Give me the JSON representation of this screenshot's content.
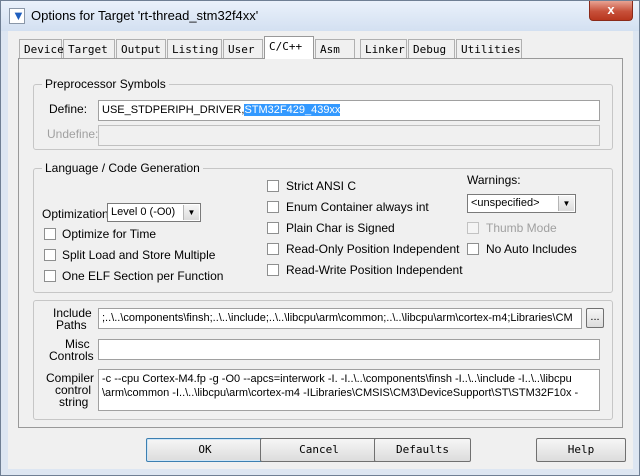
{
  "window": {
    "title": "Options for Target 'rt-thread_stm32f4xx'",
    "close_glyph": "x",
    "icon_glyph": "▼"
  },
  "tabs": [
    "Device",
    "Target",
    "Output",
    "Listing",
    "User",
    "C/C++",
    "Asm",
    "Linker",
    "Debug",
    "Utilities"
  ],
  "active_tab": "C/C++",
  "preprocessor": {
    "legend": "Preprocessor Symbols",
    "define_label": "Define:",
    "define_value_plain": "USE_STDPERIPH_DRIVER,",
    "define_value_selected": "STM32F429_439xx",
    "undefine_label": "Undefine:",
    "undefine_value": ""
  },
  "language": {
    "legend": "Language / Code Generation",
    "optimization_label": "Optimization:",
    "optimization_value": "Level 0 (-O0)",
    "optimize_time": "Optimize for Time",
    "split_load": "Split Load and Store Multiple",
    "one_elf": "One ELF Section per Function",
    "strict_ansi": "Strict ANSI C",
    "enum_container": "Enum Container always int",
    "plain_char": "Plain Char is Signed",
    "ro_pos": "Read-Only Position Independent",
    "rw_pos": "Read-Write Position Independent",
    "warnings_label": "Warnings:",
    "warnings_value": "<unspecified>",
    "thumb_mode": "Thumb Mode",
    "no_auto_includes": "No Auto Includes"
  },
  "include": {
    "label_line1": "Include",
    "label_line2": "Paths",
    "value": ";..\\..\\components\\finsh;..\\..\\include;..\\..\\libcpu\\arm\\common;..\\..\\libcpu\\arm\\cortex-m4;Libraries\\CM",
    "browse": "..."
  },
  "misc": {
    "label_line1": "Misc",
    "label_line2": "Controls",
    "value": ""
  },
  "compiler": {
    "label_line1": "Compiler",
    "label_line2": "control",
    "label_line3": "string",
    "line1": "-c --cpu Cortex-M4.fp -g -O0 --apcs=interwork -I. -I..\\..\\components\\finsh -I..\\..\\include -I..\\..\\libcpu",
    "line2": "\\arm\\common -I..\\..\\libcpu\\arm\\cortex-m4 -ILibraries\\CMSIS\\CM3\\DeviceSupport\\ST\\STM32F10x -"
  },
  "buttons": {
    "ok": "OK",
    "cancel": "Cancel",
    "defaults": "Defaults",
    "help": "Help"
  }
}
